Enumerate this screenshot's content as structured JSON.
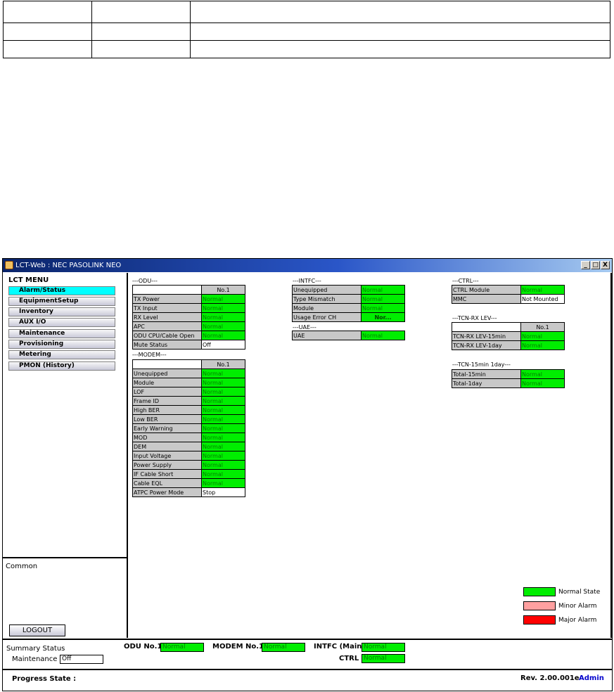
{
  "window": {
    "title": "LCT-Web : NEC PASOLINK NEO",
    "minimize": "_",
    "maximize": "□",
    "close": "X"
  },
  "menu": {
    "title": "LCT MENU",
    "items": [
      "Alarm/Status",
      "EquipmentSetup",
      "Inventory",
      "AUX I/O",
      "Maintenance",
      "Provisioning",
      "Metering",
      "PMON (History)"
    ],
    "active": "Alarm/Status",
    "common_label": "Common",
    "logout": "LOGOUT"
  },
  "odu": {
    "heading": "---ODU---",
    "column": "No.1",
    "rows": [
      {
        "label": "TX Power",
        "value": "Normal"
      },
      {
        "label": "TX Input",
        "value": "Normal"
      },
      {
        "label": "RX Level",
        "value": "Normal"
      },
      {
        "label": "APC",
        "value": "Normal"
      },
      {
        "label": "ODU CPU/Cable Open",
        "value": "Normal"
      },
      {
        "label": "Mute Status",
        "value": "Off"
      }
    ]
  },
  "modem": {
    "heading": "---MODEM---",
    "column": "No.1",
    "rows": [
      {
        "label": "Unequipped",
        "value": "Normal"
      },
      {
        "label": "Module",
        "value": "Normal"
      },
      {
        "label": "LOF",
        "value": "Normal"
      },
      {
        "label": "Frame ID",
        "value": "Normal"
      },
      {
        "label": "High BER",
        "value": "Normal"
      },
      {
        "label": "Low BER",
        "value": "Normal"
      },
      {
        "label": "Early Warning",
        "value": "Normal"
      },
      {
        "label": "MOD",
        "value": "Normal"
      },
      {
        "label": "DEM",
        "value": "Normal"
      },
      {
        "label": "Input Voltage",
        "value": "Normal"
      },
      {
        "label": "Power Supply",
        "value": "Normal"
      },
      {
        "label": "IF Cable Short",
        "value": "Normal"
      },
      {
        "label": "Cable EQL",
        "value": "Normal"
      },
      {
        "label": "ATPC Power Mode",
        "value": "Stop"
      }
    ]
  },
  "intfc": {
    "heading": "---INTFC---",
    "rows": [
      {
        "label": "Unequipped",
        "value": "Normal"
      },
      {
        "label": "Type Mismatch",
        "value": "Normal"
      },
      {
        "label": "Module",
        "value": "Normal"
      },
      {
        "label": "Usage Error CH",
        "value": "Nor..."
      }
    ]
  },
  "uae": {
    "heading": "---UAE---",
    "rows": [
      {
        "label": "UAE",
        "value": "Normal"
      }
    ]
  },
  "ctrl": {
    "heading": "---CTRL---",
    "rows": [
      {
        "label": "CTRL Module",
        "value": "Normal"
      },
      {
        "label": "MMC",
        "value": "Not Mounted"
      }
    ]
  },
  "tcn_rx": {
    "heading": "---TCN-RX LEV---",
    "column": "No.1",
    "rows": [
      {
        "label": "TCN-RX LEV-15min",
        "value": "Normal"
      },
      {
        "label": "TCN-RX LEV-1day",
        "value": "Normal"
      }
    ]
  },
  "tcn_total": {
    "heading": "---TCN-15min 1day---",
    "rows": [
      {
        "label": "Total-15min",
        "value": "Normal"
      },
      {
        "label": "Total-1day",
        "value": "Normal"
      }
    ]
  },
  "legend": {
    "items": [
      {
        "label": "Normal State",
        "color": "#00ee00"
      },
      {
        "label": "Minor Alarm",
        "color": "#ffa0a0"
      },
      {
        "label": "Major Alarm",
        "color": "#ff0000"
      }
    ]
  },
  "summary": {
    "title": "Summary Status",
    "maintenance_label": "Maintenance",
    "maintenance_value": "Off",
    "odu_label": "ODU No.1",
    "odu_value": "Normal",
    "modem_label": "MODEM No.1",
    "modem_value": "Normal",
    "intfc_label": "INTFC (Main)",
    "intfc_value": "Normal",
    "ctrl_label": "CTRL",
    "ctrl_value": "Normal",
    "progress_label": "Progress State :",
    "revision": "Rev. 2.00.001e",
    "user": "Admin"
  },
  "colors": {
    "normal": "#00ee00",
    "active_menu": "#00ffff",
    "user_link": "#0000cc"
  }
}
